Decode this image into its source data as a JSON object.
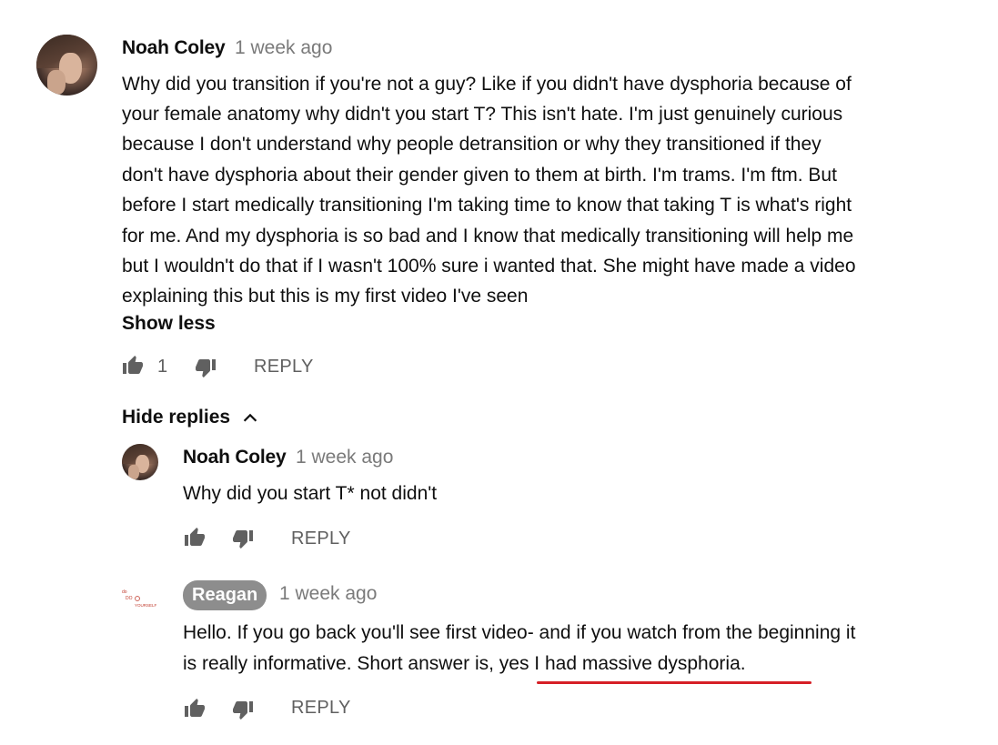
{
  "comment": {
    "author": "Noah Coley",
    "time": "1 week ago",
    "lines": [
      "Why did you transition if you're not a guy? Like if you didn't have dysphoria because of",
      "your female anatomy why didn't you start T? This isn't hate. I'm just genuinely curious",
      "because I don't understand why people detransition or why they transitioned if they",
      "don't have dysphoria about their gender given to them at birth. I'm trams. I'm ftm. But",
      "before I start medically transitioning I'm taking time to know that taking T is what's right",
      "for me. And my dysphoria is so bad and I know that medically transitioning will help me",
      "but I wouldn't do that if I wasn't 100% sure i wanted that. She might have made a video",
      "explaining this but this is my first video I've seen"
    ],
    "show_less": "Show less",
    "like_count": "1",
    "reply_label": "REPLY"
  },
  "hide_replies_label": "Hide replies",
  "replies": [
    {
      "author": "Noah Coley",
      "time": "1 week ago",
      "text": "Why did you start T* not didn't",
      "reply_label": "REPLY"
    },
    {
      "author": "Reagan",
      "time": "1 week ago",
      "line1": "Hello. If you go back you'll see first video- and if you watch from the beginning it",
      "line2_start": "is really informative. Short answer is, ",
      "line2_highlight": "yes I had massive dysphoria.",
      "reply_label": "REPLY",
      "logo_text": "DO YOURSELF"
    }
  ],
  "colors": {
    "highlight_underline": "#d61f26",
    "creator_chip": "#8d8d8d",
    "secondary_text": "#606060"
  },
  "icons": [
    "thumbs-up-icon",
    "thumbs-down-icon",
    "chevron-up-icon"
  ]
}
